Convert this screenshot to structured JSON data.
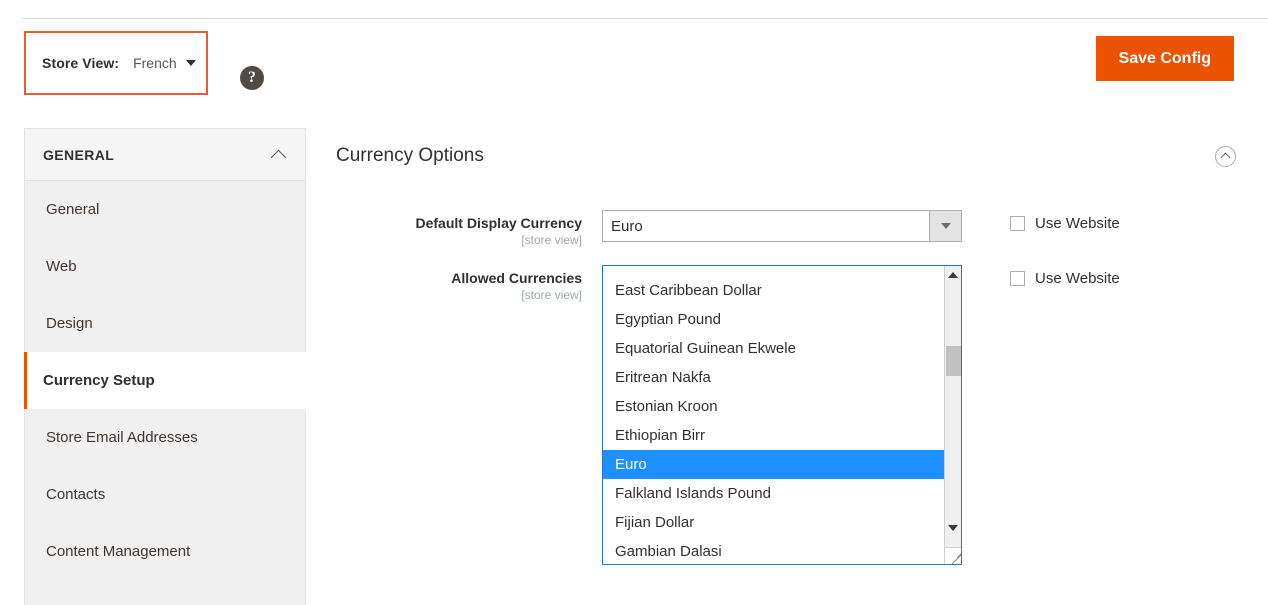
{
  "header": {
    "store_view_label": "Store View:",
    "store_view_value": "French",
    "help_icon": "question-mark-icon",
    "save_label": "Save Config"
  },
  "sidebar": {
    "section_title": "GENERAL",
    "collapse_icon": "chevron-up-icon",
    "items": [
      {
        "label": "General",
        "active": false
      },
      {
        "label": "Web",
        "active": false
      },
      {
        "label": "Design",
        "active": false
      },
      {
        "label": "Currency Setup",
        "active": true
      },
      {
        "label": "Store Email Addresses",
        "active": false
      },
      {
        "label": "Contacts",
        "active": false
      },
      {
        "label": "Content Management",
        "active": false
      }
    ]
  },
  "main": {
    "section_title": "Currency Options",
    "collapse_icon": "chevron-up-icon",
    "fields": {
      "default_display_currency": {
        "label": "Default Display Currency",
        "scope": "[store view]",
        "value": "Euro",
        "dropdown_icon": "caret-down-icon",
        "use_website_label": "Use Website",
        "use_website_checked": false
      },
      "allowed_currencies": {
        "label": "Allowed Currencies",
        "scope": "[store view]",
        "selected": "Euro",
        "options": [
          "East Caribbean Dollar",
          "Egyptian Pound",
          "Equatorial Guinean Ekwele",
          "Eritrean Nakfa",
          "Estonian Kroon",
          "Ethiopian Birr",
          "Euro",
          "Falkland Islands Pound",
          "Fijian Dollar",
          "Gambian Dalasi"
        ],
        "scroll_up_icon": "scroll-up-arrow-icon",
        "scroll_down_icon": "scroll-down-arrow-icon",
        "resize_icon": "resize-grip-icon",
        "use_website_label": "Use Website",
        "use_website_checked": false
      }
    }
  },
  "colors": {
    "accent_orange": "#eb5202",
    "highlight_blue": "#1e90ff",
    "focus_border": "#1979c3"
  }
}
